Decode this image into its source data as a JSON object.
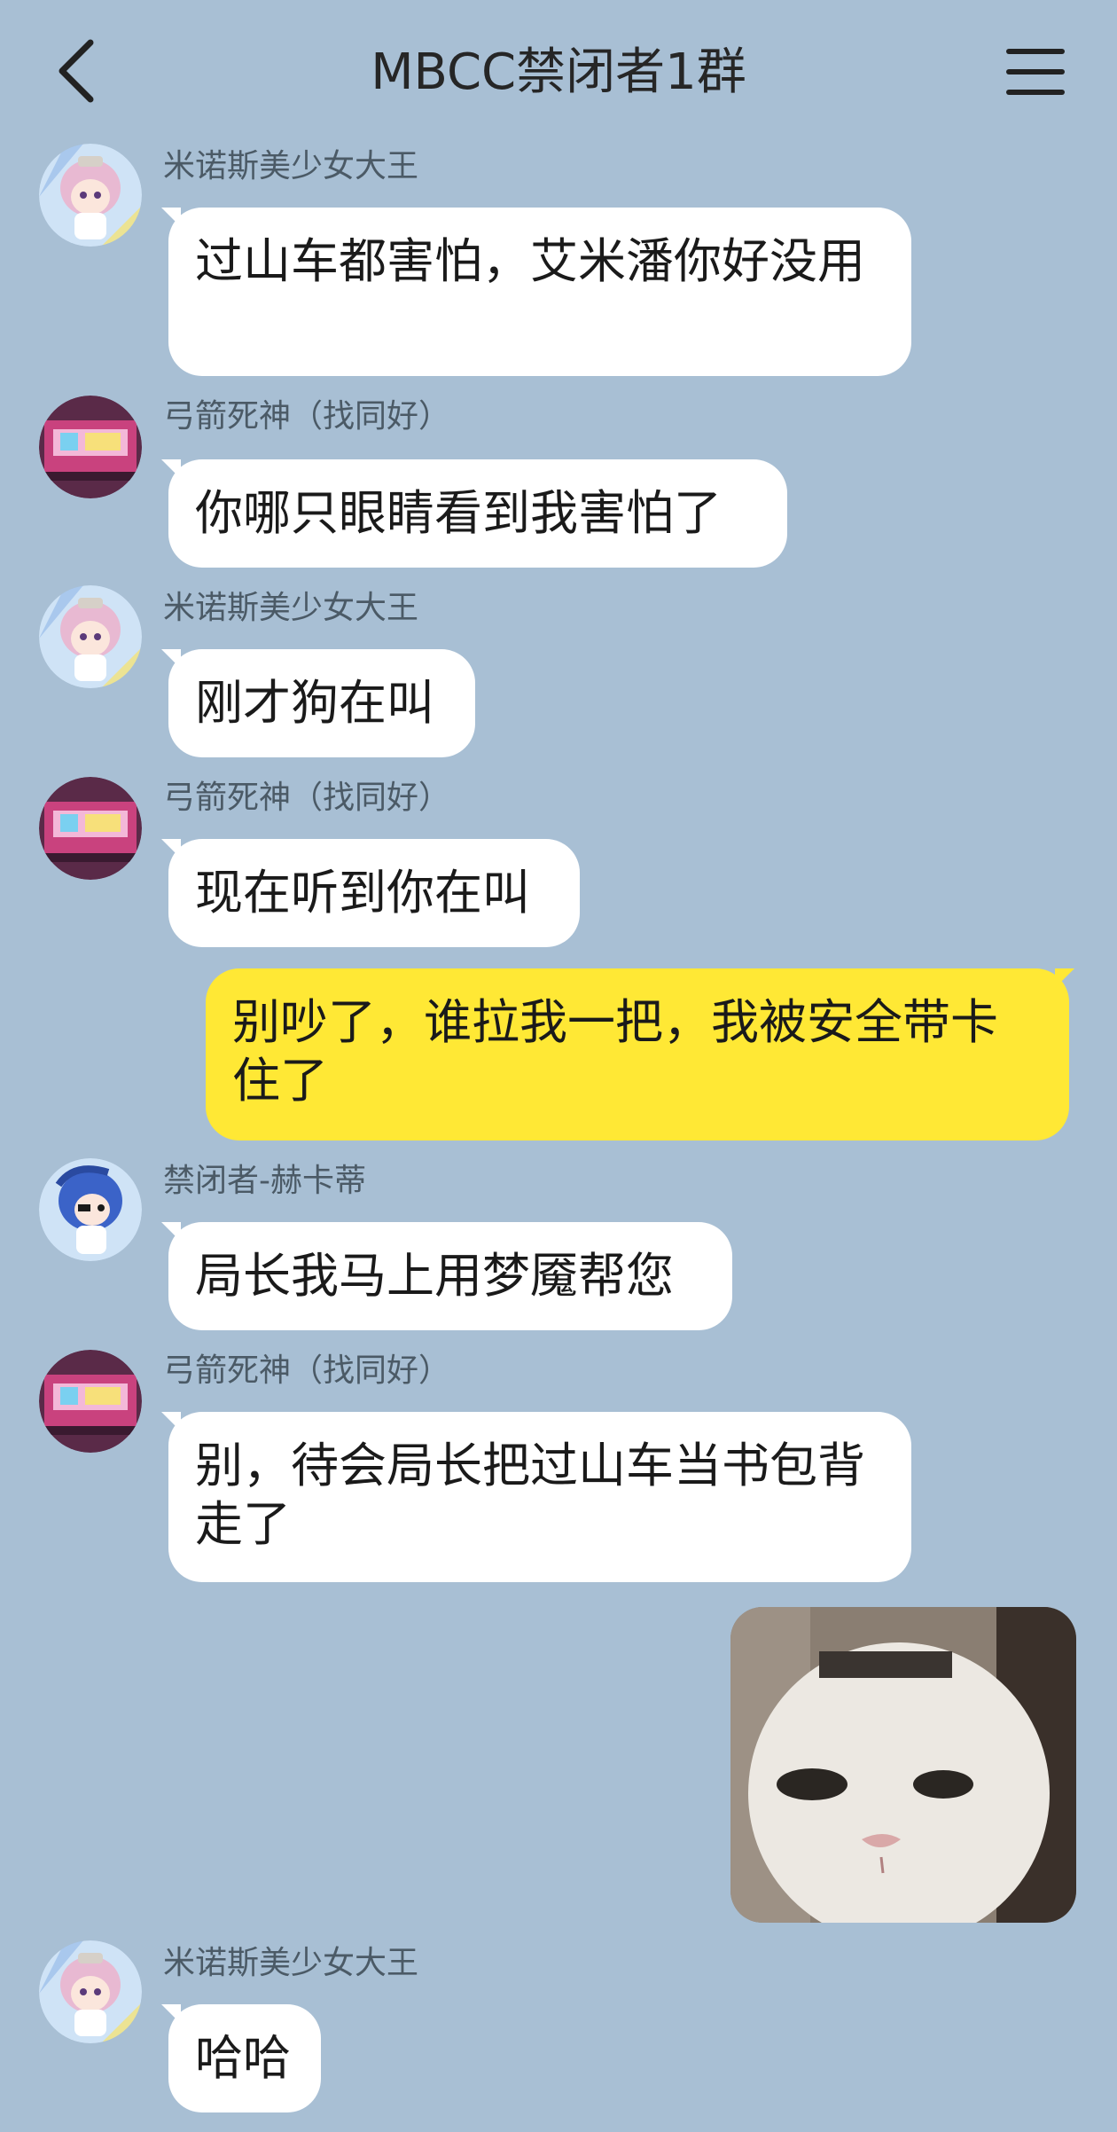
{
  "header": {
    "title": "MBCC禁闭者1群",
    "back_icon": "chevron-left-icon",
    "menu_icon": "hamburger-menu-icon"
  },
  "messages": [
    {
      "sender": "米诺斯美少女大王",
      "avatar": "pink-hair-chibi-avatar",
      "text": "过山车都害怕，艾米潘你好没用",
      "direction": "incoming"
    },
    {
      "sender": "弓箭死神（找同好）",
      "avatar": "pink-arcade-avatar",
      "text": "你哪只眼睛看到我害怕了",
      "direction": "incoming"
    },
    {
      "sender": "米诺斯美少女大王",
      "avatar": "pink-hair-chibi-avatar",
      "text": "刚才狗在叫",
      "direction": "incoming"
    },
    {
      "sender": "弓箭死神（找同好）",
      "avatar": "pink-arcade-avatar",
      "text": "现在听到你在叫",
      "direction": "incoming"
    },
    {
      "sender": "",
      "text": "别吵了，谁拉我一把，我被安全带卡住了",
      "direction": "outgoing"
    },
    {
      "sender": "禁闭者-赫卡蒂",
      "avatar": "blue-hair-chibi-avatar",
      "text": "局长我马上用梦魇帮您",
      "direction": "incoming"
    },
    {
      "sender": "弓箭死神（找同好）",
      "avatar": "pink-arcade-avatar",
      "text": "别，待会局长把过山车当书包背走了",
      "direction": "incoming"
    },
    {
      "sender": "",
      "sticker": "white-cat-face-sticker",
      "direction": "outgoing"
    },
    {
      "sender": "米诺斯美少女大王",
      "avatar": "pink-hair-chibi-avatar",
      "text": "哈哈",
      "direction": "incoming"
    }
  ],
  "colors": {
    "background": "#a8bfd4",
    "incoming_bubble": "#ffffff",
    "outgoing_bubble": "#ffe835",
    "sender_name": "#4b5a66"
  }
}
